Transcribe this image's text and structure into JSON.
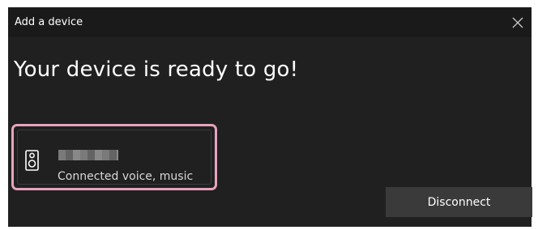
{
  "dialog": {
    "title": "Add a device",
    "heading": "Your device is ready to go!"
  },
  "device": {
    "status": "Connected voice, music"
  },
  "actions": {
    "disconnect_label": "Disconnect"
  },
  "colors": {
    "background": "#202020",
    "highlight": "#e7a3bd",
    "button": "#3a3a3a"
  },
  "icons": {
    "close": "close-icon",
    "device": "speaker-icon"
  }
}
